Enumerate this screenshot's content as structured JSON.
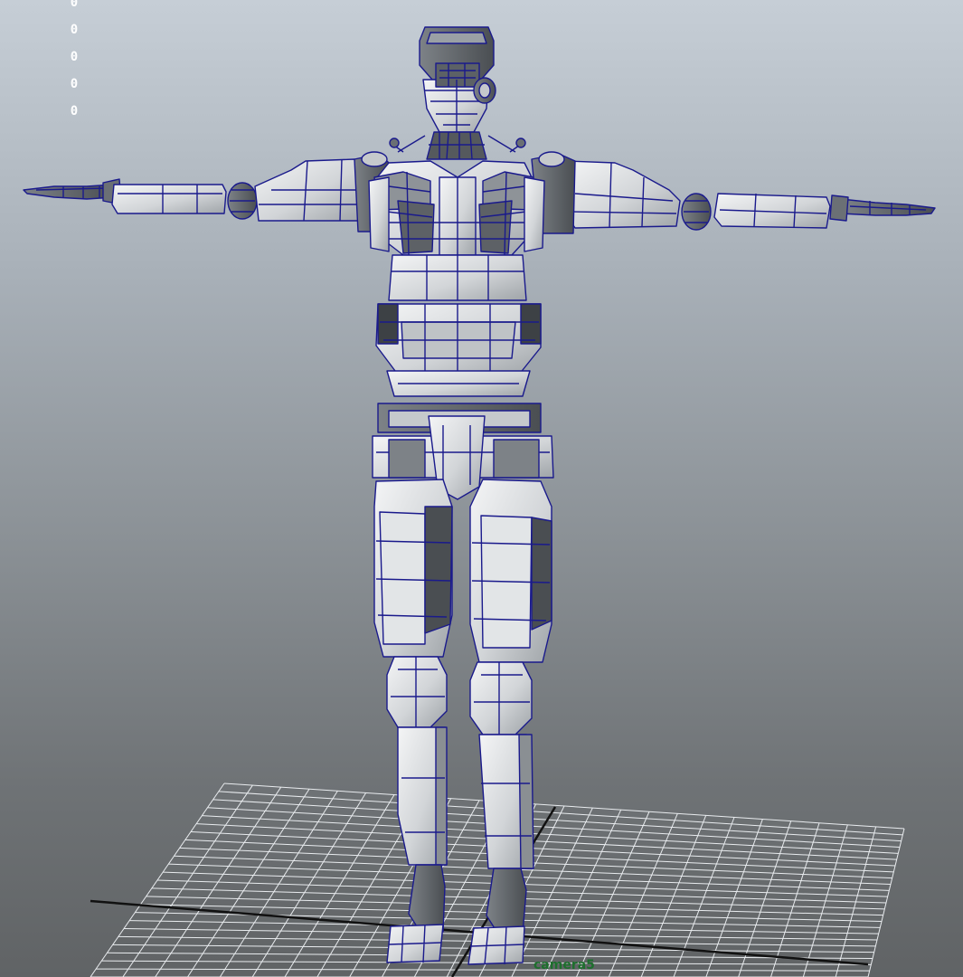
{
  "viewport": {
    "camera_name": "camera5",
    "hud_values": [
      "0",
      "0",
      "0",
      "0",
      "0"
    ],
    "colors": {
      "wireframe": "#1a1a8c",
      "mesh_fill": "#d9dcdf",
      "mesh_shadow": "#3f4348",
      "grid_line": "#e9ecef",
      "grid_axis": "#111111",
      "camera_label": "#1d6f2d",
      "background_top": "#c6ced6",
      "background_bottom": "#606365"
    }
  },
  "scene": {
    "object": "robot-mesh",
    "pose": "T-pose",
    "display_mode": "wireframe-on-shaded"
  }
}
